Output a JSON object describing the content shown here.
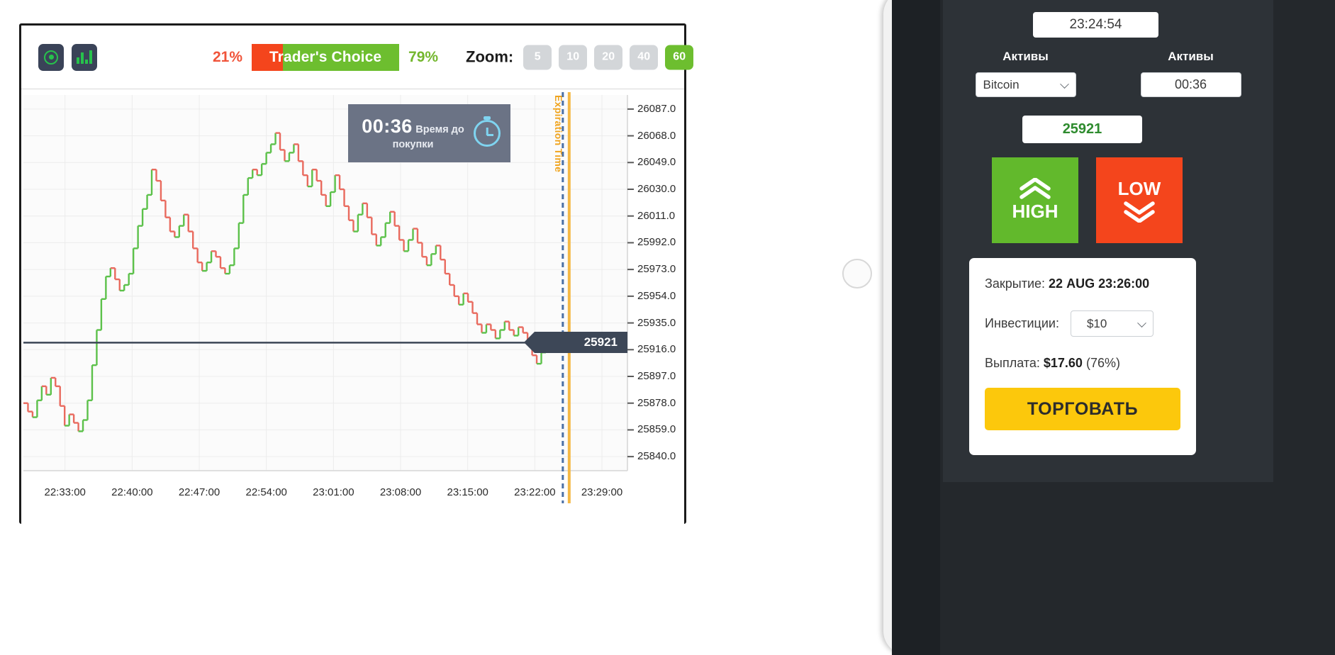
{
  "toolbar": {
    "indicator_icon": "target-circle-icon",
    "chart_type_icon": "bar-chart-icon",
    "traders_choice": {
      "label": "Trader's Choice",
      "left_percent": "21%",
      "right_percent": "79%",
      "left_value": 21,
      "right_value": 79,
      "left_color": "#f4451c",
      "right_color": "#6dbe2f"
    },
    "zoom_label": "Zoom:",
    "zoom_options": [
      {
        "label": "5",
        "active": false
      },
      {
        "label": "10",
        "active": false
      },
      {
        "label": "20",
        "active": false
      },
      {
        "label": "40",
        "active": false
      },
      {
        "label": "60",
        "active": true
      }
    ]
  },
  "countdown": {
    "time": "00:36",
    "caption": "Время до покупки",
    "clock_icon": "stopwatch-icon"
  },
  "chart_annotations": {
    "expiration_label": "Expiration Time",
    "current_price_flag": "25921"
  },
  "chart_data": {
    "type": "line",
    "title": "",
    "xlabel": "",
    "ylabel": "",
    "ylim": [
      25830,
      26097
    ],
    "xlim": [
      "22:30:00",
      "23:31:00"
    ],
    "grid": true,
    "y_ticks": [
      "26087.0",
      "26068.0",
      "26049.0",
      "26030.0",
      "26011.0",
      "25992.0",
      "25973.0",
      "25954.0",
      "25935.0",
      "25916.0",
      "25897.0",
      "25878.0",
      "25859.0",
      "25840.0"
    ],
    "y_tick_values": [
      26087.0,
      26068.0,
      26049.0,
      26030.0,
      26011.0,
      25992.0,
      25973.0,
      25954.0,
      25935.0,
      25916.0,
      25897.0,
      25878.0,
      25859.0,
      25840.0
    ],
    "x_ticks": [
      "22:33:00",
      "22:40:00",
      "22:47:00",
      "22:54:00",
      "23:01:00",
      "23:08:00",
      "23:15:00",
      "23:22:00",
      "23:29:00"
    ],
    "current_price": 25921,
    "expiration_x": "23:26:00",
    "series": [
      {
        "name": "Bitcoin price",
        "style": "stepped-ohlc",
        "up_color": "#5cc14a",
        "down_color": "#e96a5e",
        "values": [
          25878,
          25872,
          25868,
          25880,
          25890,
          25884,
          25896,
          25890,
          25876,
          25862,
          25870,
          25864,
          25858,
          25866,
          25880,
          25905,
          25930,
          25952,
          25968,
          25974,
          25966,
          25958,
          25962,
          25970,
          25988,
          26004,
          26016,
          26026,
          26044,
          26036,
          26022,
          26010,
          26000,
          25996,
          26004,
          26012,
          26000,
          25988,
          25978,
          25972,
          25978,
          25986,
          25982,
          25974,
          25970,
          25976,
          25988,
          26006,
          26026,
          26038,
          26044,
          26040,
          26048,
          26056,
          26062,
          26070,
          26058,
          26050,
          26056,
          26062,
          26050,
          26040,
          26032,
          26044,
          26036,
          26026,
          26018,
          26028,
          26040,
          26030,
          26018,
          26008,
          26000,
          26012,
          26020,
          26010,
          25998,
          25990,
          25996,
          26006,
          26014,
          26004,
          25994,
          25986,
          25994,
          26002,
          25992,
          25982,
          25976,
          25984,
          25990,
          25980,
          25970,
          25962,
          25954,
          25948,
          25956,
          25950,
          25942,
          25934,
          25928,
          25934,
          25930,
          25924,
          25930,
          25936,
          25930,
          25926,
          25932,
          25928,
          25921,
          25912,
          25906,
          25914,
          25921
        ]
      }
    ]
  },
  "panel": {
    "clock": "23:24:54",
    "asset_label_left": "Активы",
    "asset_label_right": "Активы",
    "asset_selected": "Bitcoin",
    "asset_options": [
      "Bitcoin"
    ],
    "expiry_value": "00:36",
    "price_value": "25921",
    "high_label": "HIGH",
    "high_icon": "double-chevron-up-icon",
    "low_label": "LOW",
    "low_icon": "double-chevron-down-icon",
    "colors": {
      "high": "#62b92c",
      "low": "#f4451c",
      "trade": "#fcc80c",
      "price_text": "#2e8b2e"
    },
    "card": {
      "close_label": "Закрытие:",
      "close_value": "22 AUG 23:26:00",
      "invest_label": "Инвестиции:",
      "invest_value": "$10",
      "invest_options": [
        "$10"
      ],
      "payout_label": "Выплата:",
      "payout_value": "$17.60",
      "payout_percent": "(76%)",
      "trade_button": "ТОРГОВАТЬ"
    }
  }
}
